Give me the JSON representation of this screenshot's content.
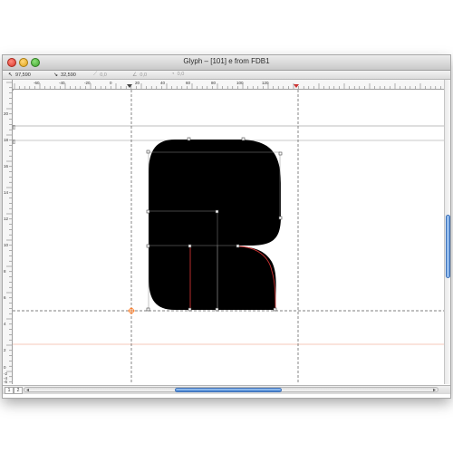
{
  "window": {
    "title": "Glyph – [101] e from FDB1"
  },
  "coords": [
    {
      "glyph": "↖",
      "value": "97,590",
      "dim": false
    },
    {
      "glyph": "↘",
      "value": "32,590",
      "dim": false
    },
    {
      "glyph": "⟋",
      "value": "0,0",
      "dim": true
    },
    {
      "glyph": "∠",
      "value": "0,0",
      "dim": true
    },
    {
      "glyph": "◔",
      "value": "0,0",
      "dim": true
    }
  ],
  "hruler": {
    "labels": [
      "-60",
      "-40",
      "-20",
      "0",
      "20",
      "40",
      "60",
      "80",
      "100",
      "120"
    ]
  },
  "vruler": {
    "labels": [
      "20",
      "18",
      "16",
      "14",
      "12",
      "10",
      "8",
      "6",
      "4",
      "2",
      "0",
      "-2",
      "-4",
      "-6"
    ]
  },
  "layer_buttons": [
    "1",
    "2"
  ],
  "scroll": {
    "vertical_position": 0.5,
    "horizontal_position": 0.6
  },
  "colors": {
    "accent": "#4f86d1",
    "glyph_fill": "#000000",
    "guide": "#cc3333",
    "origin_marker": "#ff6600"
  }
}
